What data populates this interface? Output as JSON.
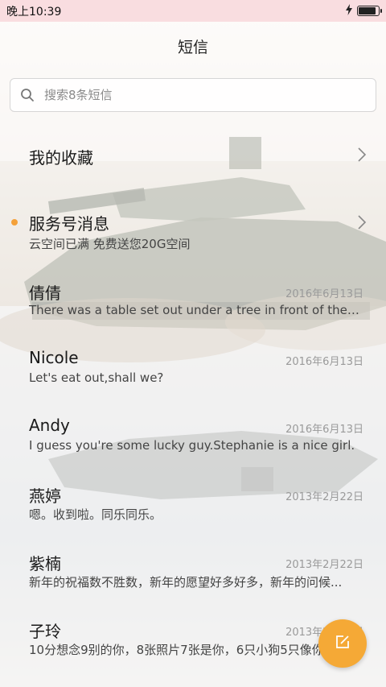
{
  "status_bar": {
    "time": "晚上10:39",
    "battery_level": 0.95
  },
  "header": {
    "title": "短信"
  },
  "search": {
    "placeholder": "搜索8条短信"
  },
  "threads": [
    {
      "name": "我的收藏",
      "preview": "",
      "date": "",
      "has_chevron": true,
      "unread": false
    },
    {
      "name": "服务号消息",
      "preview": "云空间已满 免费送您20G空间",
      "date": "",
      "has_chevron": true,
      "unread": true
    },
    {
      "name": "倩倩",
      "preview": "There was a table set out under a tree in front of the ho...",
      "date": "2016年6月13日",
      "has_chevron": false,
      "unread": false
    },
    {
      "name": "Nicole",
      "preview": "Let's eat out,shall we?",
      "date": "2016年6月13日",
      "has_chevron": false,
      "unread": false
    },
    {
      "name": "Andy",
      "preview": "I guess you're some lucky guy.Stephanie is a nice girl.",
      "date": "2016年6月13日",
      "has_chevron": false,
      "unread": false
    },
    {
      "name": "燕婷",
      "preview": "嗯。收到啦。同乐同乐。",
      "date": "2013年2月22日",
      "has_chevron": false,
      "unread": false
    },
    {
      "name": "紫楠",
      "preview": "新年的祝福数不胜数，新年的愿望好多好多，新年的问候...",
      "date": "2013年2月22日",
      "has_chevron": false,
      "unread": false
    },
    {
      "name": "子玲",
      "preview": "10分想念9别的你，8张照片7张是你，6只小狗5只像你",
      "date": "2013年2月22日",
      "has_chevron": false,
      "unread": false
    }
  ],
  "colors": {
    "accent": "#f5a936",
    "status_bar_bg": "#f9dde0",
    "unread_dot": "#f4a13a"
  },
  "icons": {
    "search": "search-icon",
    "chevron": "chevron-right-icon",
    "compose": "compose-icon",
    "lightning": "charging-icon"
  }
}
